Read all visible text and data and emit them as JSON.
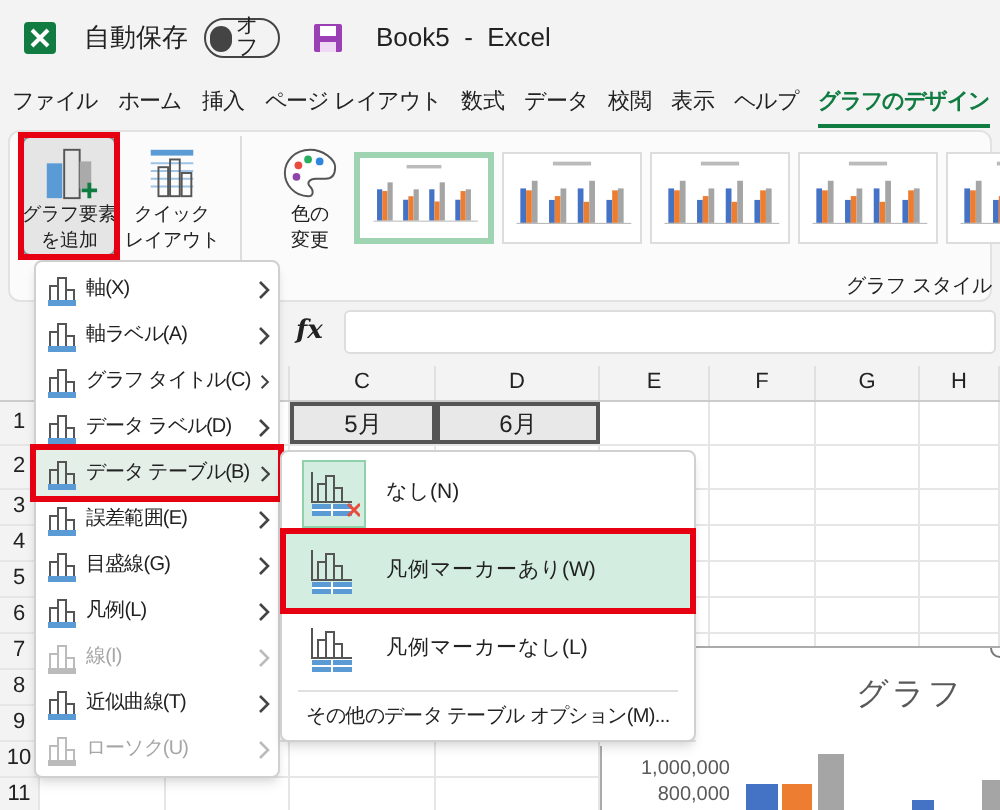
{
  "title_bar": {
    "autosave_label": "自動保存",
    "autosave": {
      "text": "オフ",
      "on": false
    },
    "title": "Book5  -  Excel"
  },
  "tabs": [
    {
      "label": "ファイル",
      "selected": false
    },
    {
      "label": "ホーム",
      "selected": false
    },
    {
      "label": "挿入",
      "selected": false
    },
    {
      "label": "ページ レイアウト",
      "selected": false
    },
    {
      "label": "数式",
      "selected": false
    },
    {
      "label": "データ",
      "selected": false
    },
    {
      "label": "校閲",
      "selected": false
    },
    {
      "label": "表示",
      "selected": false
    },
    {
      "label": "ヘルプ",
      "selected": false
    },
    {
      "label": "グラフのデザイン",
      "selected": true
    }
  ],
  "ribbon": {
    "buttons": [
      {
        "lines": [
          "グラフ要素",
          "を追加"
        ],
        "pressed": true,
        "annotated": true
      },
      {
        "lines": [
          "クイック",
          "レイアウト"
        ],
        "pressed": false,
        "annotated": false
      },
      {
        "lines": [
          "色の",
          "変更"
        ],
        "pressed": false,
        "annotated": false
      }
    ],
    "chart_styles": [
      {
        "selected": true
      },
      {
        "selected": false
      },
      {
        "selected": false
      },
      {
        "selected": false
      },
      {
        "selected": false
      }
    ],
    "group_label": "グラフ スタイル"
  },
  "formula_bar": {
    "fx": "fx"
  },
  "sheet": {
    "columns": [
      "C",
      "D",
      "E",
      "F",
      "G",
      "H"
    ],
    "rows": [
      "1",
      "2",
      "3",
      "4",
      "5",
      "6",
      "7",
      "8",
      "9",
      "10",
      "11"
    ],
    "row_1_cells": [
      "5月",
      "6月"
    ]
  },
  "chart": {
    "title": "グラフ",
    "axis_labels": [
      "1,000,000",
      "800,000"
    ]
  },
  "menu": [
    {
      "label": "軸(X)",
      "selected": false,
      "disabled": false,
      "annotated": false
    },
    {
      "label": "軸ラベル(A)",
      "selected": false,
      "disabled": false,
      "annotated": false
    },
    {
      "label": "グラフ タイトル(C)",
      "selected": false,
      "disabled": false,
      "annotated": false
    },
    {
      "label": "データ ラベル(D)",
      "selected": false,
      "disabled": false,
      "annotated": false
    },
    {
      "label": "データ テーブル(B)",
      "selected": true,
      "disabled": false,
      "annotated": true
    },
    {
      "label": "誤差範囲(E)",
      "selected": false,
      "disabled": false,
      "annotated": false
    },
    {
      "label": "目盛線(G)",
      "selected": false,
      "disabled": false,
      "annotated": false
    },
    {
      "label": "凡例(L)",
      "selected": false,
      "disabled": false,
      "annotated": false
    },
    {
      "label": "線(I)",
      "selected": false,
      "disabled": true,
      "annotated": false
    },
    {
      "label": "近似曲線(T)",
      "selected": false,
      "disabled": false,
      "annotated": false
    },
    {
      "label": "ローソク(U)",
      "selected": false,
      "disabled": true,
      "annotated": false
    }
  ],
  "submenu": {
    "items": [
      {
        "label": "なし(N)",
        "selected": false,
        "current": true,
        "annotated": false
      },
      {
        "label": "凡例マーカーあり(W)",
        "selected": true,
        "current": false,
        "annotated": true
      },
      {
        "label": "凡例マーカーなし(L)",
        "selected": false,
        "current": false,
        "annotated": false
      }
    ],
    "footer": "その他のデータ テーブル オプション(M)..."
  }
}
